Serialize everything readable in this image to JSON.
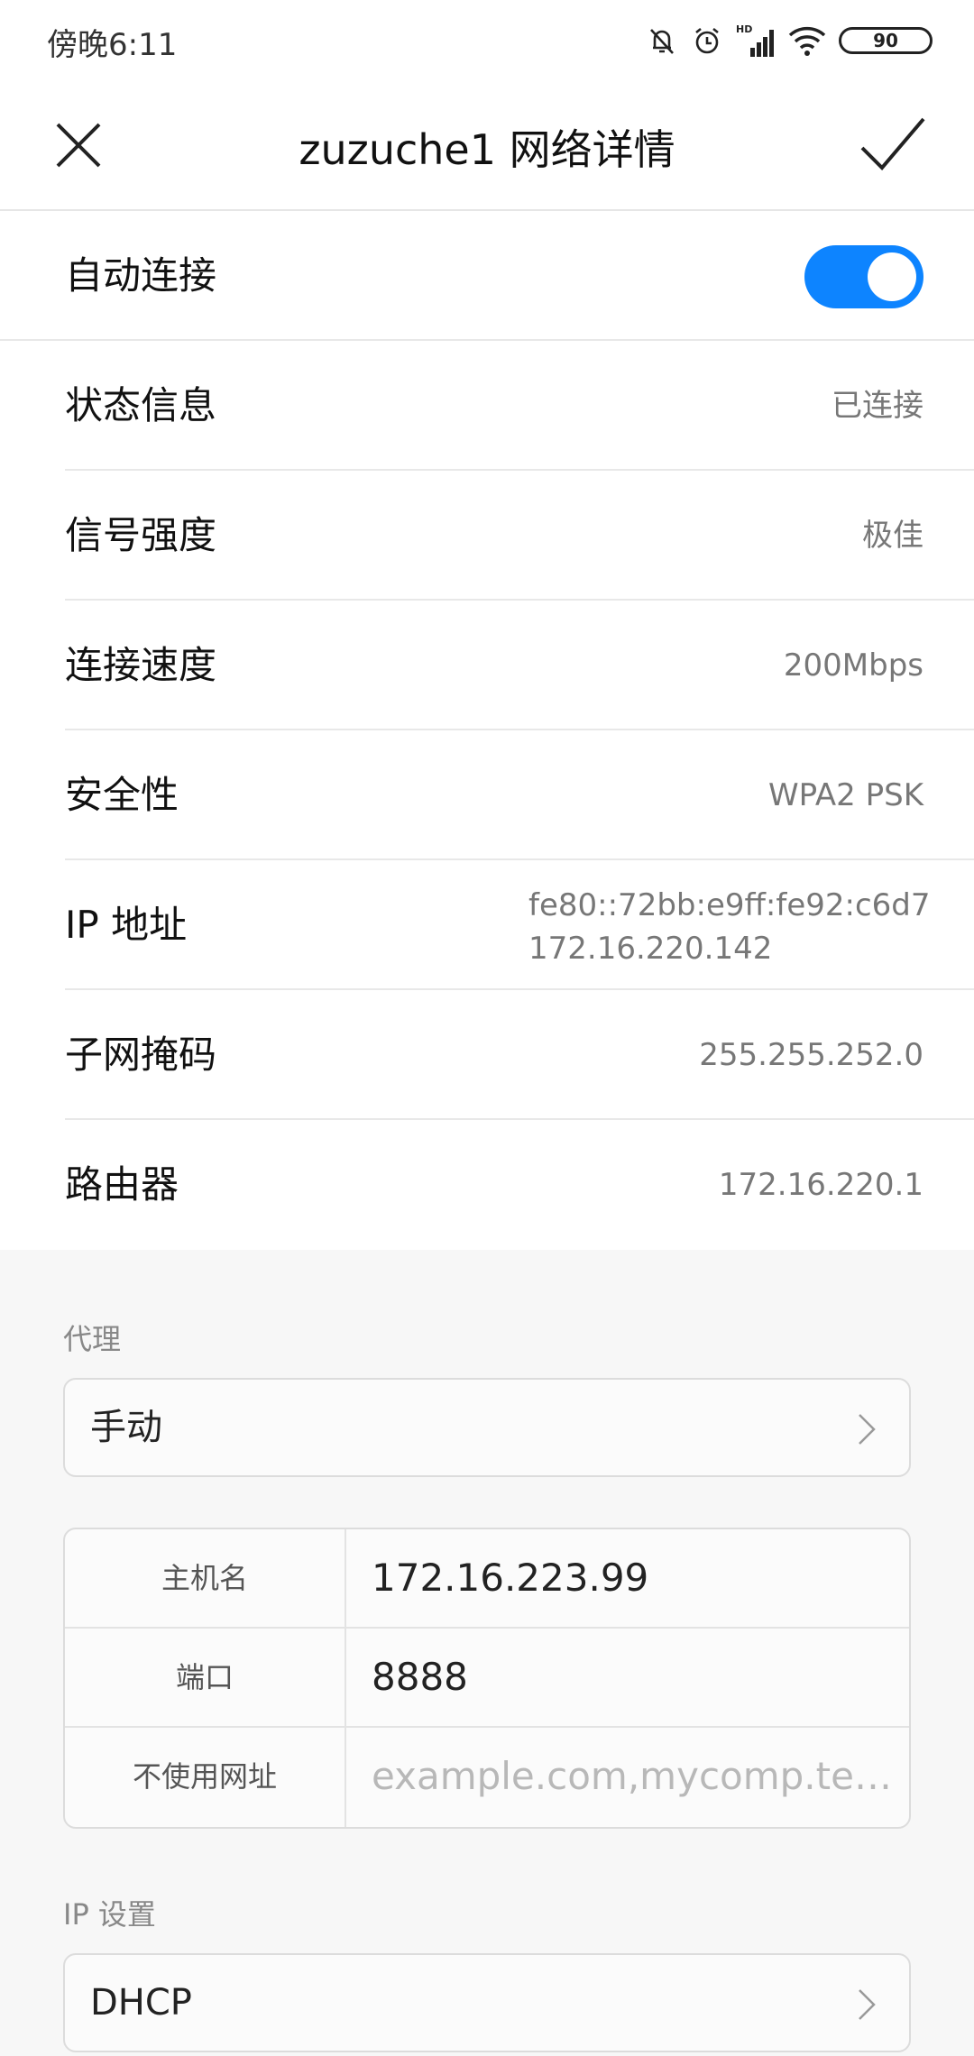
{
  "status_bar": {
    "time": "傍晚6:11",
    "battery": "90",
    "icons": [
      "bell-muted-icon",
      "alarm-icon",
      "hd-signal-icon",
      "wifi-icon",
      "battery-icon"
    ]
  },
  "header": {
    "title": "zuzuche1  网络详情",
    "close_icon": "close-icon",
    "confirm_icon": "check-icon"
  },
  "details": {
    "auto_connect": {
      "label": "自动连接",
      "enabled": true
    },
    "status": {
      "label": "状态信息",
      "value": "已连接"
    },
    "signal": {
      "label": "信号强度",
      "value": "极佳"
    },
    "speed": {
      "label": "连接速度",
      "value": "200Mbps"
    },
    "security": {
      "label": "安全性",
      "value": "WPA2 PSK"
    },
    "ip": {
      "label": "IP 地址",
      "value_v6": "fe80::72bb:e9ff:fe92:c6d7",
      "value_v4": "172.16.220.142"
    },
    "subnet": {
      "label": "子网掩码",
      "value": "255.255.252.0"
    },
    "router": {
      "label": "路由器",
      "value": "172.16.220.1"
    }
  },
  "proxy": {
    "section_label": "代理",
    "mode": "手动",
    "host": {
      "label": "主机名",
      "value": "172.16.223.99"
    },
    "port": {
      "label": "端口",
      "value": "8888"
    },
    "bypass": {
      "label": "不使用网址",
      "placeholder": "example.com,mycomp.test...."
    }
  },
  "ip_settings": {
    "section_label": "IP 设置",
    "mode": "DHCP"
  },
  "colors": {
    "accent": "#0d84ff",
    "secondary_text": "#777777",
    "background": "#f7f7f7"
  }
}
